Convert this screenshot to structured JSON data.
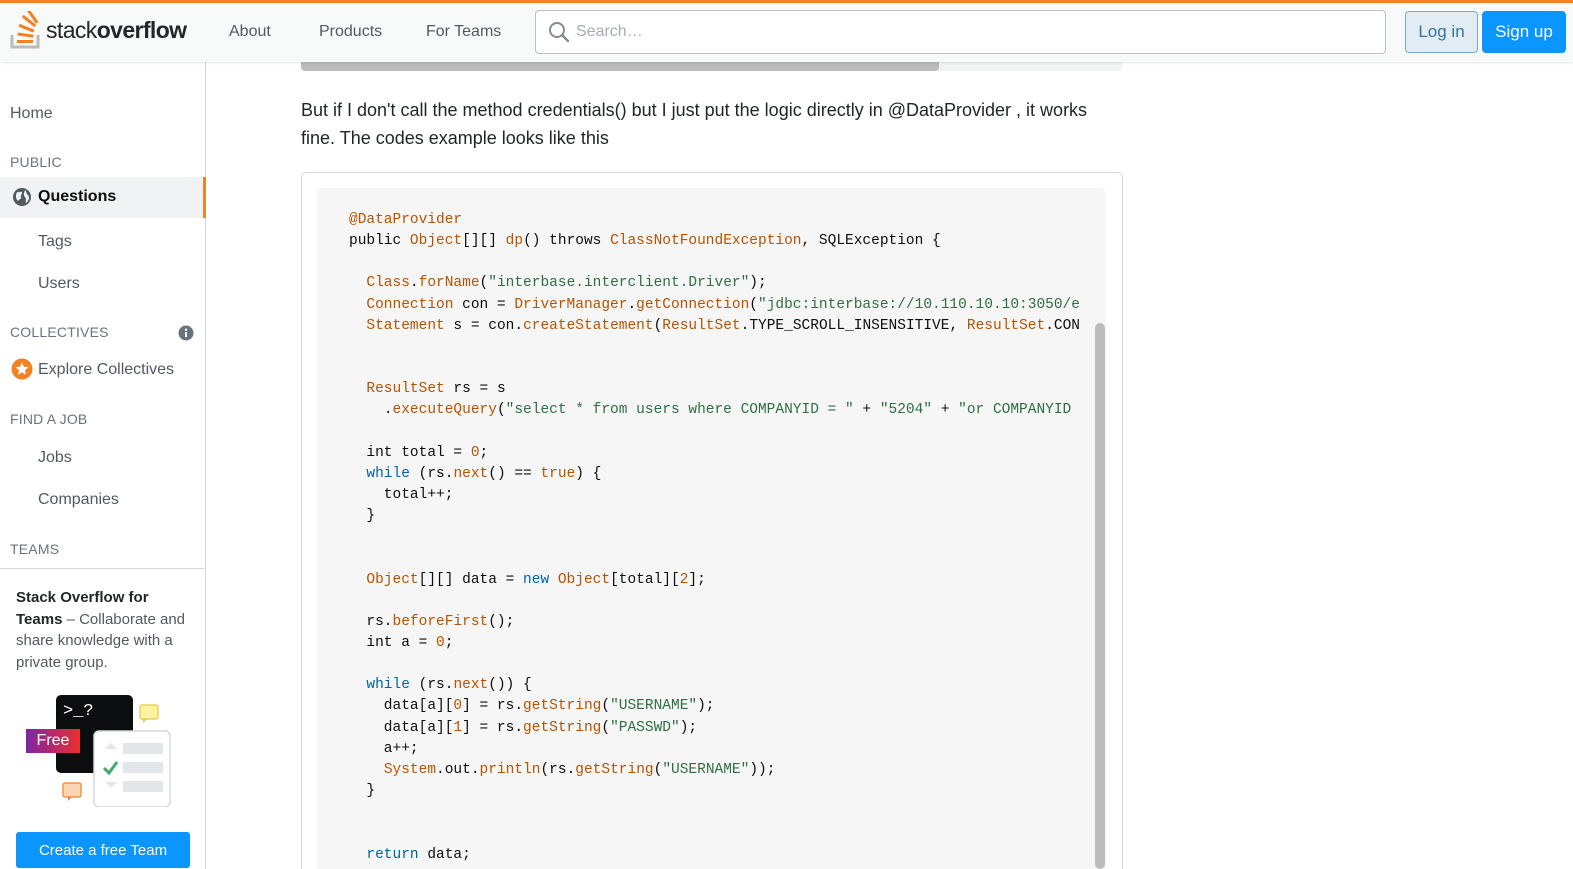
{
  "header": {
    "logo_light": "stack",
    "logo_bold": "overflow",
    "nav": [
      "About",
      "Products",
      "For Teams"
    ],
    "search_placeholder": "Search…",
    "login_label": "Log in",
    "signup_label": "Sign up"
  },
  "sidebar": {
    "home": "Home",
    "public_heading": "PUBLIC",
    "questions": "Questions",
    "tags": "Tags",
    "users": "Users",
    "collectives_heading": "COLLECTIVES",
    "explore_collectives": "Explore Collectives",
    "find_job_heading": "FIND A JOB",
    "jobs": "Jobs",
    "companies": "Companies",
    "teams_heading": "TEAMS",
    "teams_promo_bold": "Stack Overflow for Teams",
    "teams_promo_rest": " – Collaborate and share knowledge with a private group.",
    "free_badge": "Free",
    "create_team_label": "Create a free Team",
    "illustration_prompt": ">_?"
  },
  "main": {
    "paragraph": "But if I don't call the method credentials() but I just put the logic directly in @DataProvider , it works fine. The codes example looks like this",
    "code_lines": [
      [
        [
          "t",
          "@DataProvider"
        ]
      ],
      [
        [
          "p",
          "public "
        ],
        [
          "t",
          "Object"
        ],
        [
          "p",
          "[][] "
        ],
        [
          "t",
          "dp"
        ],
        [
          "p",
          "() throws "
        ],
        [
          "t",
          "ClassNotFoundException"
        ],
        [
          "p",
          ", SQLException {"
        ]
      ],
      [],
      [
        [
          "p",
          "  "
        ],
        [
          "t",
          "Class"
        ],
        [
          "p",
          "."
        ],
        [
          "t",
          "forName"
        ],
        [
          "p",
          "("
        ],
        [
          "s",
          "\"interbase.interclient.Driver\""
        ],
        [
          "p",
          ");"
        ]
      ],
      [
        [
          "p",
          "  "
        ],
        [
          "t",
          "Connection"
        ],
        [
          "p",
          " con = "
        ],
        [
          "t",
          "DriverManager"
        ],
        [
          "p",
          "."
        ],
        [
          "t",
          "getConnection"
        ],
        [
          "p",
          "("
        ],
        [
          "s",
          "\"jdbc:interbase://10.110.10.10:3050/e"
        ]
      ],
      [
        [
          "p",
          "  "
        ],
        [
          "t",
          "Statement"
        ],
        [
          "p",
          " s = con."
        ],
        [
          "t",
          "createStatement"
        ],
        [
          "p",
          "("
        ],
        [
          "t",
          "ResultSet"
        ],
        [
          "p",
          ".TYPE_SCROLL_INSENSITIVE, "
        ],
        [
          "t",
          "ResultSet"
        ],
        [
          "p",
          ".CON"
        ]
      ],
      [],
      [],
      [
        [
          "p",
          "  "
        ],
        [
          "t",
          "ResultSet"
        ],
        [
          "p",
          " rs = s"
        ]
      ],
      [
        [
          "p",
          "    ."
        ],
        [
          "t",
          "executeQuery"
        ],
        [
          "p",
          "("
        ],
        [
          "s",
          "\"select * from users where COMPANYID = \""
        ],
        [
          "p",
          " + "
        ],
        [
          "s",
          "\"5204\""
        ],
        [
          "p",
          " + "
        ],
        [
          "s",
          "\"or COMPANYID"
        ]
      ],
      [],
      [
        [
          "p",
          "  int total = "
        ],
        [
          "n",
          "0"
        ],
        [
          "p",
          ";"
        ]
      ],
      [
        [
          "p",
          "  "
        ],
        [
          "k",
          "while"
        ],
        [
          "p",
          " (rs."
        ],
        [
          "t",
          "next"
        ],
        [
          "p",
          "() == "
        ],
        [
          "t",
          "true"
        ],
        [
          "p",
          ") {"
        ]
      ],
      [
        [
          "p",
          "    total++;"
        ]
      ],
      [
        [
          "p",
          "  }"
        ]
      ],
      [],
      [],
      [
        [
          "p",
          "  "
        ],
        [
          "t",
          "Object"
        ],
        [
          "p",
          "[][] data = "
        ],
        [
          "k",
          "new "
        ],
        [
          "t",
          "Object"
        ],
        [
          "p",
          "[total]["
        ],
        [
          "n",
          "2"
        ],
        [
          "p",
          "];"
        ]
      ],
      [],
      [
        [
          "p",
          "  rs."
        ],
        [
          "t",
          "beforeFirst"
        ],
        [
          "p",
          "();"
        ]
      ],
      [
        [
          "p",
          "  int a = "
        ],
        [
          "n",
          "0"
        ],
        [
          "p",
          ";"
        ]
      ],
      [],
      [
        [
          "p",
          "  "
        ],
        [
          "k",
          "while"
        ],
        [
          "p",
          " (rs."
        ],
        [
          "t",
          "next"
        ],
        [
          "p",
          "()) {"
        ]
      ],
      [
        [
          "p",
          "    data[a]["
        ],
        [
          "n",
          "0"
        ],
        [
          "p",
          "] = rs."
        ],
        [
          "t",
          "getString"
        ],
        [
          "p",
          "("
        ],
        [
          "s",
          "\"USERNAME\""
        ],
        [
          "p",
          ");"
        ]
      ],
      [
        [
          "p",
          "    data[a]["
        ],
        [
          "n",
          "1"
        ],
        [
          "p",
          "] = rs."
        ],
        [
          "t",
          "getString"
        ],
        [
          "p",
          "("
        ],
        [
          "s",
          "\"PASSWD\""
        ],
        [
          "p",
          ");"
        ]
      ],
      [
        [
          "p",
          "    a++;"
        ]
      ],
      [
        [
          "p",
          "    "
        ],
        [
          "t",
          "System"
        ],
        [
          "p",
          ".out."
        ],
        [
          "t",
          "println"
        ],
        [
          "p",
          "(rs."
        ],
        [
          "t",
          "getString"
        ],
        [
          "p",
          "("
        ],
        [
          "s",
          "\"USERNAME\""
        ],
        [
          "p",
          "));"
        ]
      ],
      [
        [
          "p",
          "  }"
        ]
      ],
      [],
      [],
      [
        [
          "p",
          "  "
        ],
        [
          "k",
          "return"
        ],
        [
          "p",
          " data;"
        ]
      ]
    ]
  },
  "colors": {
    "accent_orange": "#f48225",
    "primary_blue": "#0a95ff",
    "code_type": "#b75301",
    "code_keyword": "#0064a8",
    "code_string": "#2f6f44"
  }
}
